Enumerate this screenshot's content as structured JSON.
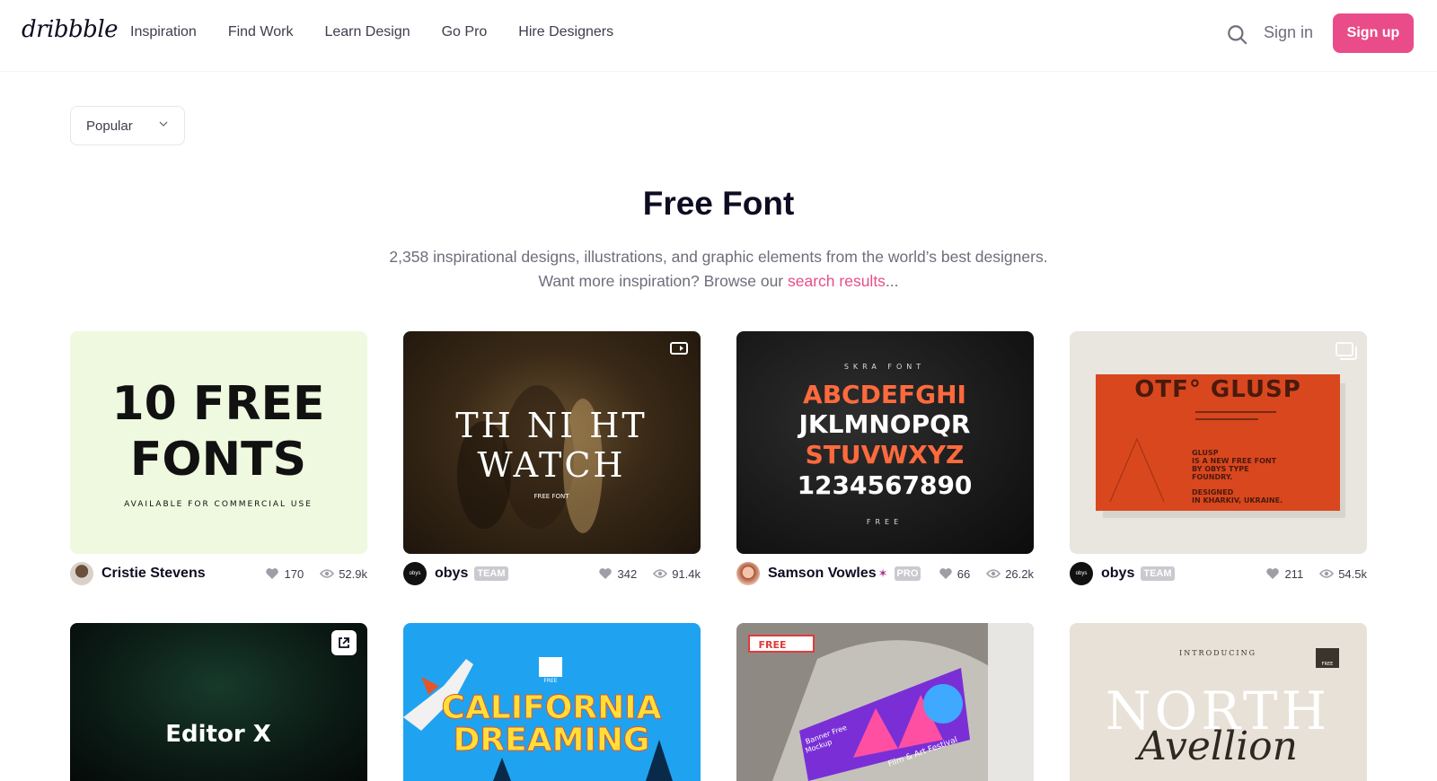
{
  "header": {
    "logo": "dribbble",
    "nav": [
      "Inspiration",
      "Find Work",
      "Learn Design",
      "Go Pro",
      "Hire Designers"
    ],
    "sign_in": "Sign in",
    "sign_up": "Sign up",
    "accent": "#ea4c89"
  },
  "filter": {
    "selected": "Popular"
  },
  "page": {
    "title": "Free Font",
    "subtitle_line1": "2,358 inspirational designs, illustrations, and graphic elements from the world’s best designers.",
    "subtitle_line2_prefix": "Want more inspiration? Browse our ",
    "subtitle_link": "search results",
    "subtitle_suffix": "..."
  },
  "shots": [
    {
      "author": "Cristie Stevens",
      "badge": "",
      "likes": "170",
      "views": "52.9k",
      "art": {
        "line1": "10 FREE",
        "line2": "FONTS",
        "caption": "AVAILABLE FOR COMMERCIAL USE"
      }
    },
    {
      "author": "obys",
      "badge": "TEAM",
      "likes": "342",
      "views": "91.4k",
      "art": {
        "line1": "TH NI HT",
        "line2": "WATCH",
        "caption": "FREE FONT"
      }
    },
    {
      "author": "Samson Vowles",
      "badge": "PRO",
      "likes": "66",
      "views": "26.2k",
      "art": {
        "top": "SKRA FONT",
        "r1": "ABCDEFGHI",
        "r2": "JKLMNOPQR",
        "r3": "STUVWXYZ",
        "r4": "1234567890",
        "bottom": "FREE"
      }
    },
    {
      "author": "obys",
      "badge": "TEAM",
      "likes": "211",
      "views": "54.5k",
      "art": {
        "headline": "OTF° GLUSP",
        "body1": "GLUSP",
        "body2": "IS A NEW FREE FONT",
        "body3": "BY OBYS TYPE",
        "body4": "FOUNDRY.",
        "body5": "DESIGNED",
        "body6": "IN KHARKIV, UKRAINE."
      }
    },
    {
      "art": {
        "text": "Editor X"
      }
    },
    {
      "art": {
        "line1": "CALIFORNIA",
        "line2": "DREAMING",
        "tag": "FREE"
      }
    },
    {
      "art": {
        "tag": "FREE",
        "banner1": "Banner Free",
        "banner2": "Mockup",
        "banner3": "Film & Art Festival"
      }
    },
    {
      "art": {
        "intro": "INTRODUCING",
        "big": "NORTH",
        "script": "Avellion",
        "tag": "FREE"
      }
    }
  ]
}
